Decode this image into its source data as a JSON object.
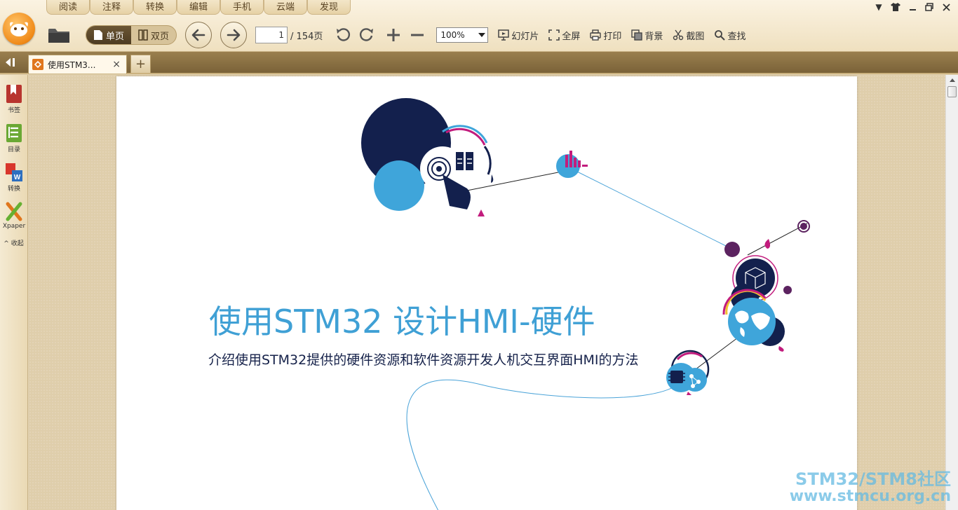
{
  "menu": {
    "tabs": [
      "阅读",
      "注释",
      "转换",
      "编辑",
      "手机",
      "云端",
      "发现"
    ]
  },
  "toolbar": {
    "single_page": "单页",
    "double_page": "双页",
    "current_page": "1",
    "total_pages": "/ 154页",
    "zoom": "100%",
    "slideshow": "幻灯片",
    "fullscreen": "全屏",
    "print": "打印",
    "background": "背景",
    "screenshot": "截图",
    "search": "查找"
  },
  "tabbar": {
    "doc_tab_title": "使用STM3...",
    "close_symbol": "×",
    "new_tab_symbol": "+"
  },
  "sidebar": {
    "bookmark": "书签",
    "toc": "目录",
    "convert": "转换",
    "xpaper": "Xpaper",
    "collapse": "^ 收起"
  },
  "document": {
    "title": "使用STM32 设计HMI-硬件",
    "subtitle": "介绍使用STM32提供的硬件资源和软件资源开发人机交互界面HMI的方法"
  },
  "watermark": {
    "line1": "STM32/STM8社区",
    "line2": "www.stmcu.org.cn"
  },
  "colors": {
    "title_blue": "#3fa0d5",
    "navy": "#13204d",
    "accent_magenta": "#c21c7d",
    "accent_purple": "#5c2360"
  }
}
